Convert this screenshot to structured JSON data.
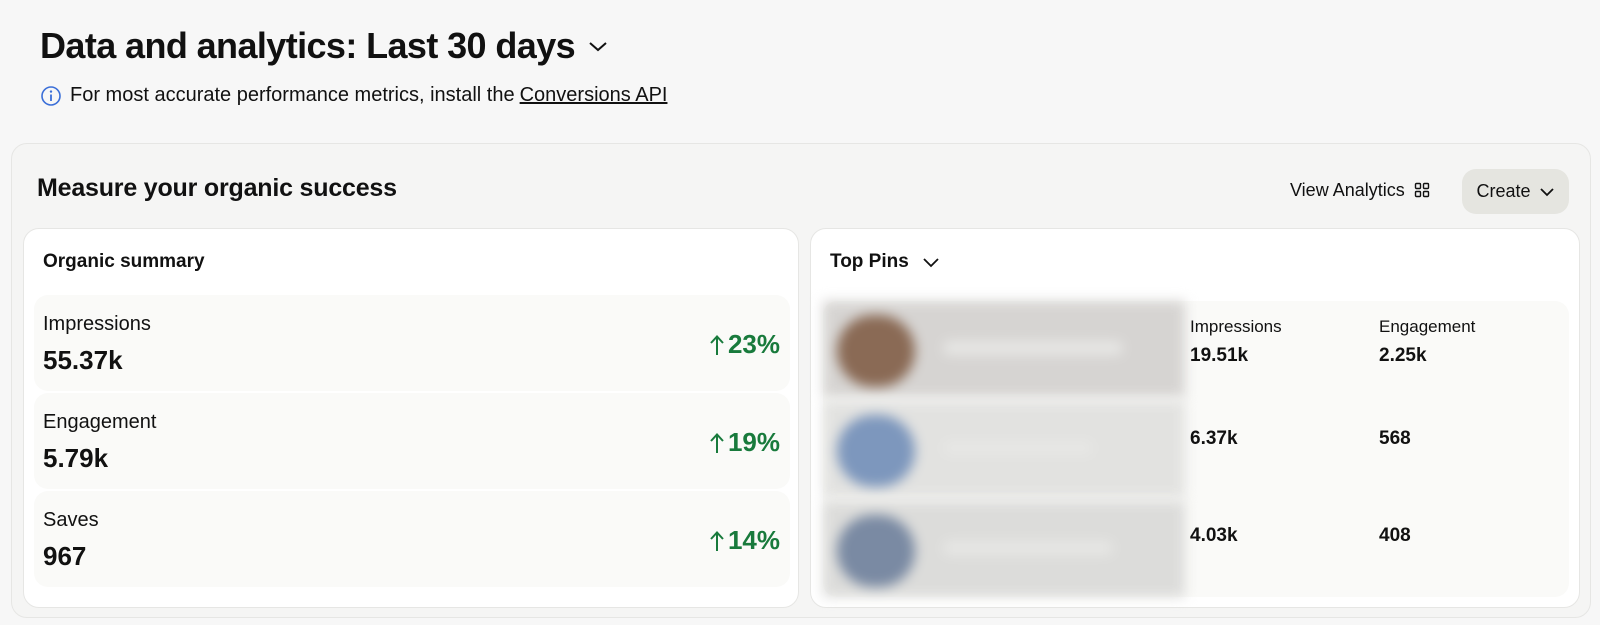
{
  "header": {
    "title": "Data and analytics: Last 30 days",
    "info_text": "For most accurate performance metrics, install the",
    "info_link": "Conversions API"
  },
  "card": {
    "title": "Measure your organic success",
    "view_analytics_label": "View Analytics",
    "create_label": "Create"
  },
  "organic_summary": {
    "title": "Organic summary",
    "metrics": [
      {
        "label": "Impressions",
        "value": "55.37k",
        "change": "23%"
      },
      {
        "label": "Engagement",
        "value": "5.79k",
        "change": "19%"
      },
      {
        "label": "Saves",
        "value": "967",
        "change": "14%"
      }
    ]
  },
  "top_pins": {
    "title": "Top Pins",
    "col_impressions": "Impressions",
    "col_engagement": "Engagement",
    "pins": [
      {
        "impressions": "19.51k",
        "engagement": "2.25k"
      },
      {
        "impressions": "6.37k",
        "engagement": "568"
      },
      {
        "impressions": "4.03k",
        "engagement": "408"
      }
    ]
  },
  "colors": {
    "positive": "#187a3c",
    "info_icon": "#3b6fd8",
    "create_button_bg": "#e5e5e0"
  },
  "icons": {
    "title_dropdown": "chevron-down-icon",
    "info": "info-icon",
    "view_analytics": "grid-icon",
    "create_dropdown": "chevron-down-icon",
    "change_arrow": "arrow-up-icon"
  }
}
